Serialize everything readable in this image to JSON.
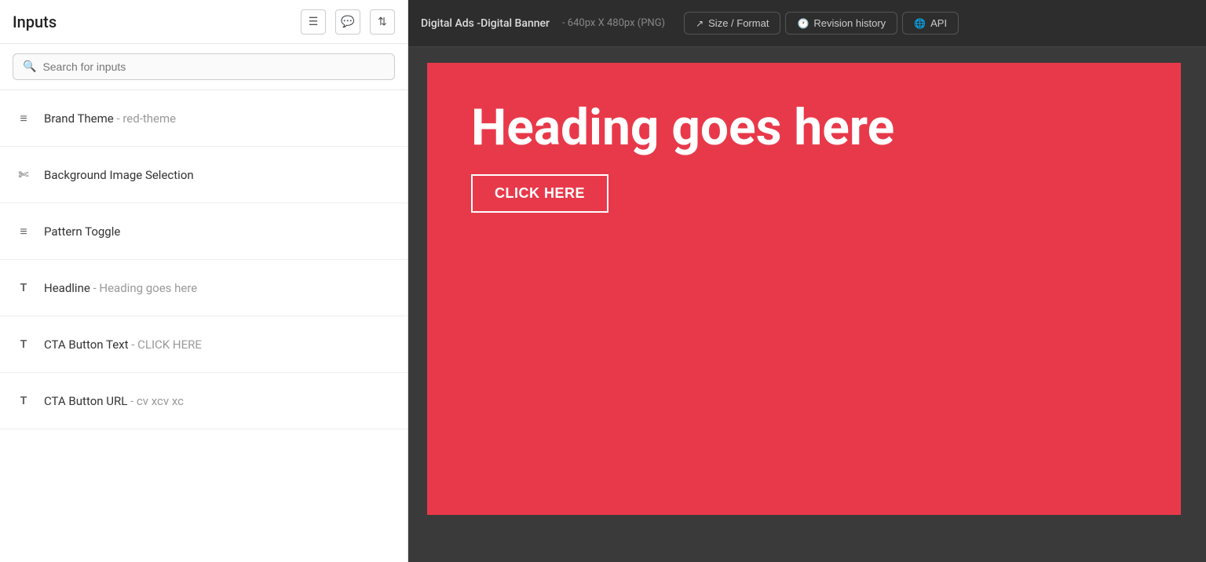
{
  "leftPanel": {
    "title": "Inputs",
    "headerIcons": [
      {
        "name": "list-icon",
        "symbol": "☰"
      },
      {
        "name": "comment-icon",
        "symbol": "💬"
      },
      {
        "name": "expand-icon",
        "symbol": "⤢"
      }
    ],
    "search": {
      "placeholder": "Search for inputs"
    },
    "items": [
      {
        "id": "brand-theme",
        "iconType": "list",
        "label": "Brand Theme",
        "secondary": " - red-theme"
      },
      {
        "id": "background-image",
        "iconType": "image",
        "label": "Background Image Selection",
        "secondary": ""
      },
      {
        "id": "pattern-toggle",
        "iconType": "list",
        "label": "Pattern Toggle",
        "secondary": ""
      },
      {
        "id": "headline",
        "iconType": "text",
        "label": "Headline",
        "secondary": " - Heading goes here"
      },
      {
        "id": "cta-button-text",
        "iconType": "text",
        "label": "CTA Button Text",
        "secondary": " - CLICK HERE"
      },
      {
        "id": "cta-button-url",
        "iconType": "text",
        "label": "CTA Button URL",
        "secondary": " - cv xcv xc"
      }
    ]
  },
  "rightPanel": {
    "title": "Digital Ads -Digital Banner",
    "subtitle": " - 640px X 480px (PNG)",
    "toolbar": {
      "buttons": [
        {
          "id": "size-format",
          "icon": "↗",
          "label": "Size / Format"
        },
        {
          "id": "revision-history",
          "icon": "🕐",
          "label": "Revision history"
        },
        {
          "id": "api",
          "icon": "🌐",
          "label": "API"
        }
      ]
    },
    "canvas": {
      "backgroundColor": "#e8394a",
      "heading": "Heading goes here",
      "ctaLabel": "CLICK HERE"
    }
  }
}
